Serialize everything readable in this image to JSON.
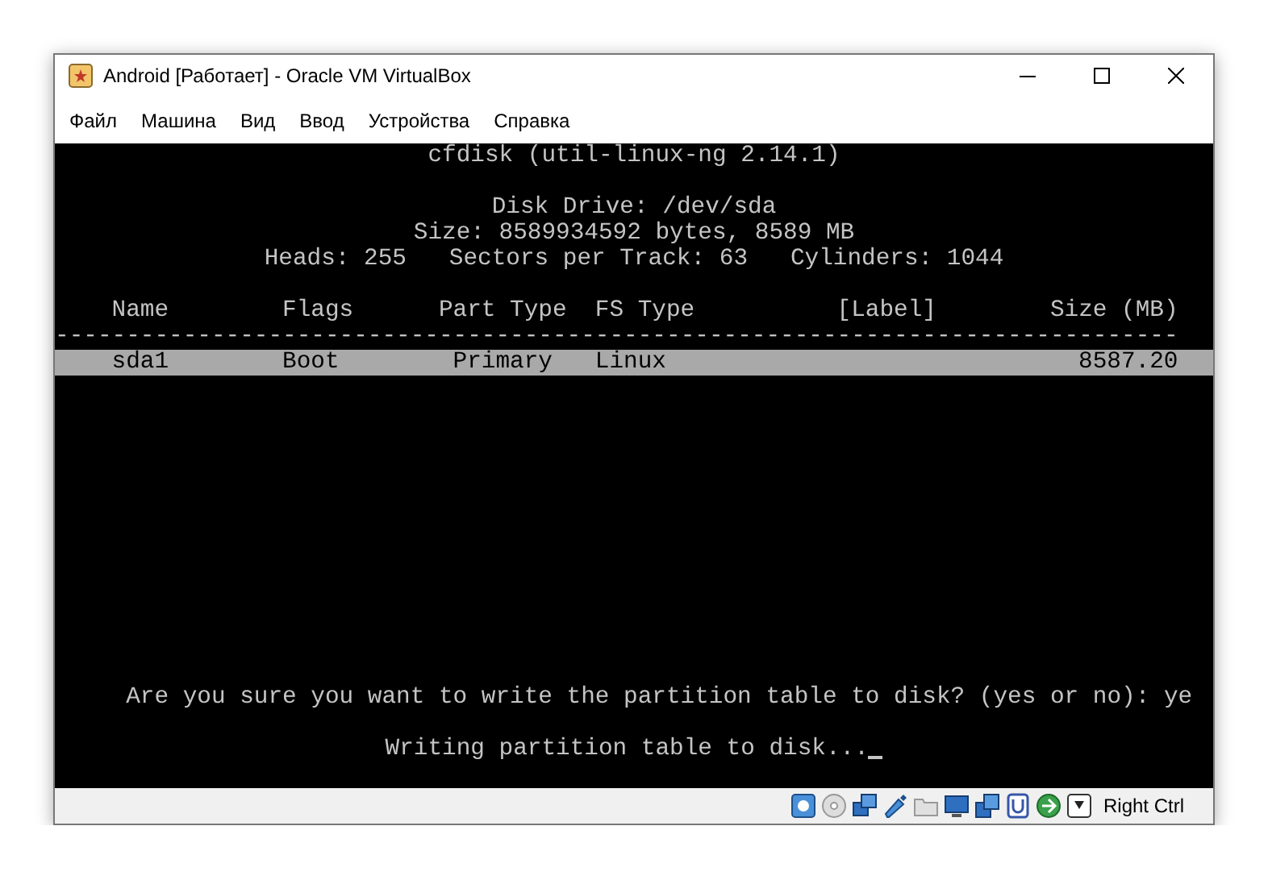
{
  "window": {
    "title": "Android [Работает] - Oracle VM VirtualBox"
  },
  "menu": [
    "Файл",
    "Машина",
    "Вид",
    "Ввод",
    "Устройства",
    "Справка"
  ],
  "console": {
    "title": "cfdisk (util-linux-ng 2.14.1)",
    "disk_drive": "Disk Drive: /dev/sda",
    "size": "Size: 8589934592 bytes, 8589 MB",
    "geometry": "Heads: 255   Sectors per Track: 63   Cylinders: 1044",
    "table": {
      "columns": [
        "Name",
        "Flags",
        "Part Type",
        "FS Type",
        "[Label]",
        "Size (MB)"
      ],
      "separator": "-------------------------------------------------------------------------------",
      "rows": [
        {
          "cells": [
            "sda1",
            "Boot",
            "Primary",
            "Linux",
            "",
            "8587.20"
          ],
          "selected": true
        }
      ]
    },
    "prompt": "Are you sure you want to write the partition table to disk? (yes or no): ye",
    "message": "Writing partition table to disk...",
    "cursor": true
  },
  "status_bar": {
    "host_key": "Right Ctrl"
  }
}
